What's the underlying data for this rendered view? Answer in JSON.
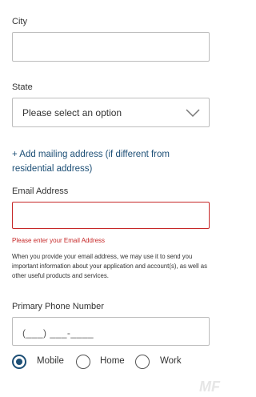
{
  "city": {
    "label": "City",
    "value": ""
  },
  "state": {
    "label": "State",
    "selected": "Please select an option"
  },
  "mailing_link": "+ Add mailing address (if different from residential address)",
  "email": {
    "label": "Email Address",
    "value": "",
    "error": "Please enter your Email Address",
    "help": "When you provide your email address, we may use it to send you important information about your application and account(s), as well as other useful products and services."
  },
  "phone": {
    "label": "Primary Phone Number",
    "mask": "(___) ___-____"
  },
  "phone_type": {
    "options": [
      "Mobile",
      "Home",
      "Work"
    ],
    "selected": "Mobile"
  },
  "colors": {
    "accent": "#1d4f76",
    "error": "#c62828",
    "border": "#bdbdbd"
  }
}
